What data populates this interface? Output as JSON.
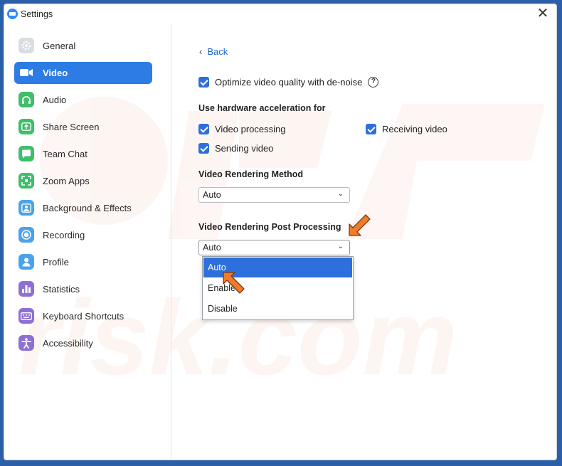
{
  "window": {
    "title": "Settings",
    "close_glyph": "✕"
  },
  "sidebar": {
    "items": [
      {
        "label": "General",
        "icon": "gear-icon",
        "color": "#d9dde3",
        "active": false
      },
      {
        "label": "Video",
        "icon": "video-camera-icon",
        "color": "#ffffff",
        "active": true
      },
      {
        "label": "Audio",
        "icon": "headphones-icon",
        "color": "#3fbf6a",
        "active": false
      },
      {
        "label": "Share Screen",
        "icon": "share-screen-icon",
        "color": "#3fbf6a",
        "active": false
      },
      {
        "label": "Team Chat",
        "icon": "chat-bubble-icon",
        "color": "#3fbf6a",
        "active": false
      },
      {
        "label": "Zoom Apps",
        "icon": "apps-icon",
        "color": "#3fbf6a",
        "active": false
      },
      {
        "label": "Background & Effects",
        "icon": "background-person-icon",
        "color": "#4aa3ea",
        "active": false
      },
      {
        "label": "Recording",
        "icon": "record-icon",
        "color": "#4aa3ea",
        "active": false
      },
      {
        "label": "Profile",
        "icon": "profile-icon",
        "color": "#4aa3ea",
        "active": false
      },
      {
        "label": "Statistics",
        "icon": "statistics-icon",
        "color": "#8d6fd6",
        "active": false
      },
      {
        "label": "Keyboard Shortcuts",
        "icon": "keyboard-icon",
        "color": "#8d6fd6",
        "active": false
      },
      {
        "label": "Accessibility",
        "icon": "accessibility-icon",
        "color": "#8d6fd6",
        "active": false
      }
    ]
  },
  "content": {
    "back_label": "Back",
    "back_glyph": "‹",
    "optimize_label": "Optimize video quality with de-noise",
    "help_glyph": "?",
    "hw_accel_label": "Use hardware acceleration for",
    "video_processing_label": "Video processing",
    "receiving_video_label": "Receiving video",
    "sending_video_label": "Sending video",
    "rendering_method_label": "Video Rendering Method",
    "rendering_method_value": "Auto",
    "post_processing_label": "Video Rendering Post Processing",
    "post_processing_value": "Auto",
    "dropdown_glyph": "⌄",
    "dropdown_options": [
      "Auto",
      "Enable",
      "Disable"
    ],
    "dropdown_selected": "Auto"
  },
  "colors": {
    "accent": "#2d7be5",
    "checkbox": "#2d6fdc",
    "annotation_arrow": "#f07c2a",
    "frame": "#2b5fa8"
  },
  "watermark": {
    "text": "risk.com"
  }
}
